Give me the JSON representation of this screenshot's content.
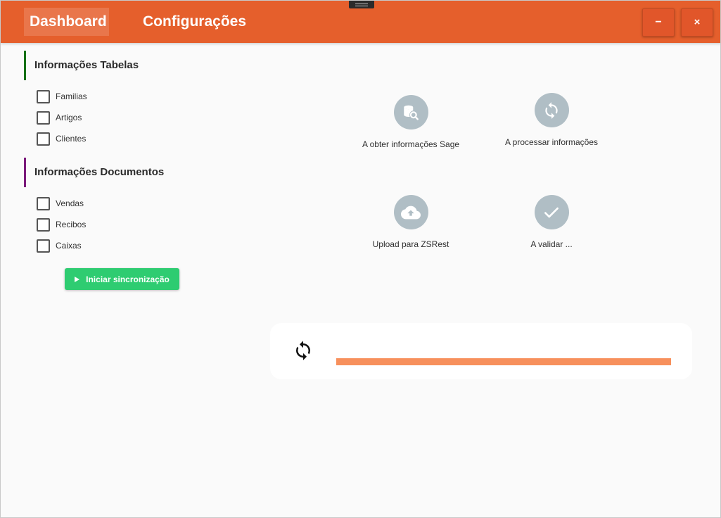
{
  "titlebar": {
    "tabs": [
      {
        "label": "Dashboard",
        "active": true
      },
      {
        "label": "Configurações",
        "active": false
      }
    ],
    "minimize_label": "−",
    "close_label": "×",
    "color": "#e55f2c"
  },
  "sections": {
    "tabelas": {
      "title": "Informações Tabelas",
      "items": [
        "Familias",
        "Artigos",
        "Clientes"
      ]
    },
    "documentos": {
      "title": "Informações Documentos",
      "items": [
        "Vendas",
        "Recibos",
        "Caixas"
      ]
    }
  },
  "sync_button": {
    "label": "Iniciar sincronização",
    "icon": "play-icon",
    "color": "#2ecc71"
  },
  "steps": [
    {
      "label": "A obter informações Sage",
      "icon": "database-search-icon"
    },
    {
      "label": "A processar informações",
      "icon": "sync-icon"
    },
    {
      "label": "Upload para ZSRest",
      "icon": "cloud-upload-icon"
    },
    {
      "label": "A validar ...",
      "icon": "check-icon"
    }
  ],
  "progress": {
    "icon": "sync-icon",
    "value": 1.0,
    "fill_color": "#f7905c"
  }
}
